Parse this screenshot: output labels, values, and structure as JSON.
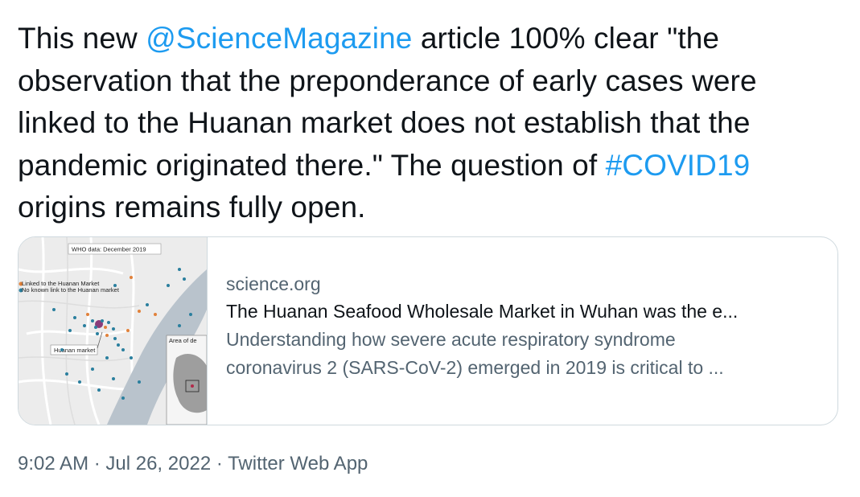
{
  "tweet": {
    "text_1": "This new ",
    "mention": "@ScienceMagazine",
    "text_2": " article 100% clear \"the observation that the preponderance of early cases were linked to the Huanan market does not establish that the pandemic originated there.\" The question of ",
    "hashtag": "#COVID19",
    "text_3": " origins remains fully open."
  },
  "card": {
    "domain": "science.org",
    "title": "The Huanan Seafood Wholesale Market in Wuhan was the e...",
    "description_line1": "Understanding how severe acute respiratory syndrome",
    "description_line2": "coronavirus 2 (SARS-CoV-2) emerged in 2019 is critical to ...",
    "thumbnail": {
      "map_title": "WHO data: December 2019",
      "legend_1": "Linked to the Huanan Market",
      "legend_2": "No known link to the Huanan market",
      "market_label": "Huanan market",
      "inset_label": "Area of de"
    }
  },
  "meta": {
    "time": "9:02 AM",
    "separator_1": " · ",
    "date": "Jul 26, 2022",
    "separator_2": " · ",
    "source": "Twitter Web App"
  },
  "colors": {
    "link": "#1d9bf0",
    "text": "#0f1419",
    "secondary": "#536471",
    "border": "#cfd9de"
  }
}
